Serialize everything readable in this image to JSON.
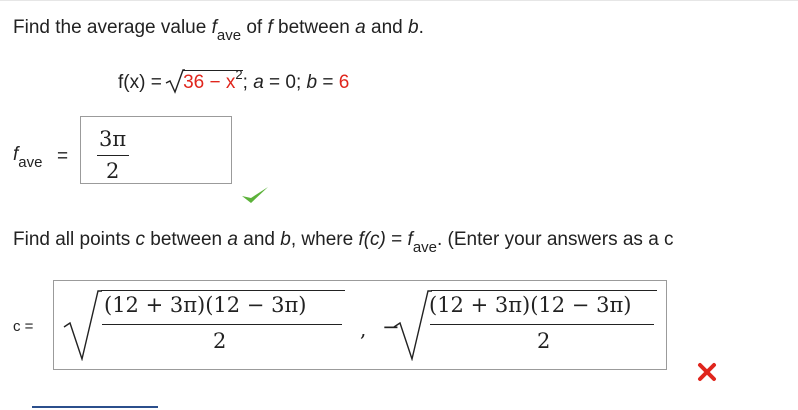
{
  "problem1": {
    "title_prefix": "Find the average value ",
    "f_symbol": "f",
    "ave_sub": "ave",
    "title_suffix": " of ",
    "f_italic": "f",
    "between": " between ",
    "a": "a",
    "and": " and ",
    "b": "b",
    "period": ".",
    "function_lhs": "f(x) = ",
    "radicand": "36 − x",
    "exponent": "2",
    "semi": "; ",
    "a_eq": "a",
    "a_value": " = 0; ",
    "b_eq": "b",
    "b_value_eq": " = ",
    "b_value": "6"
  },
  "answer1": {
    "label_f": "f",
    "label_sub": "ave",
    "equals": "=",
    "numerator": "3π",
    "denominator": "2",
    "status": "correct"
  },
  "problem2": {
    "text_prefix": "Find all points ",
    "c": "c",
    "between": " between ",
    "a": "a",
    "and": " and ",
    "b": "b",
    "where": ", where ",
    "fc": "f(c)",
    "eq": " = ",
    "f": "f",
    "ave_sub": "ave",
    "text_suffix": ". (Enter your answers as a c"
  },
  "answer2": {
    "label": "c =",
    "root1_numerator": "(12 + 3π)(12 − 3π)",
    "root1_denominator": "2",
    "separator": ",",
    "minus": "−",
    "root2_numerator": "(12 + 3π)(12 − 3π)",
    "root2_denominator": "2",
    "status": "incorrect"
  },
  "colors": {
    "check": "#5cb23a",
    "cross": "#e0261d",
    "highlight_value": "#e0261d"
  }
}
